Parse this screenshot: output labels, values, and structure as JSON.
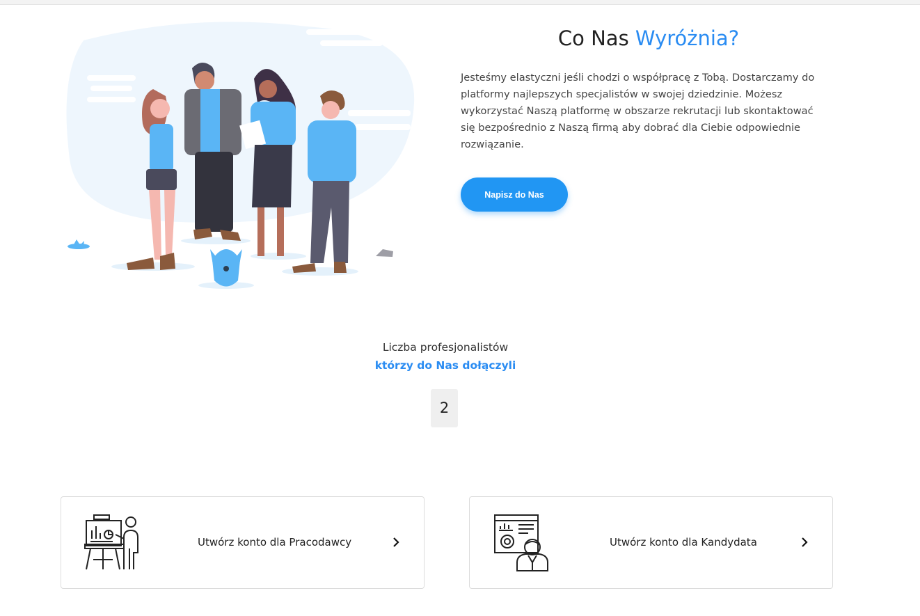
{
  "hero": {
    "title_plain": "Co Nas ",
    "title_accent": "Wyróżnia?",
    "text": "Jesteśmy elastyczni jeśli chodzi o współpracę z Tobą. Dostarczamy do platformy najlepszych specjalistów w swojej dziedzinie. Możesz wykorzystać Naszą platformę w obszarze rekrutacji lub skontaktować się bezpośrednio z Naszą firmą aby dobrać dla Ciebie odpowiednie rozwiązanie.",
    "cta_label": "Napisz do Nas"
  },
  "stats": {
    "label": "Liczba profesjonalistów",
    "sublabel": "którzy do Nas dołączyli",
    "count": "2"
  },
  "cards": [
    {
      "label": "Utwórz konto dla Pracodawcy",
      "icon": "presentation-board-icon"
    },
    {
      "label": "Utwórz konto dla Kandydata",
      "icon": "candidate-dashboard-icon"
    }
  ],
  "colors": {
    "accent": "#2a8cf2",
    "button": "#2196f3",
    "illustration_blue": "#5ab5f5"
  }
}
